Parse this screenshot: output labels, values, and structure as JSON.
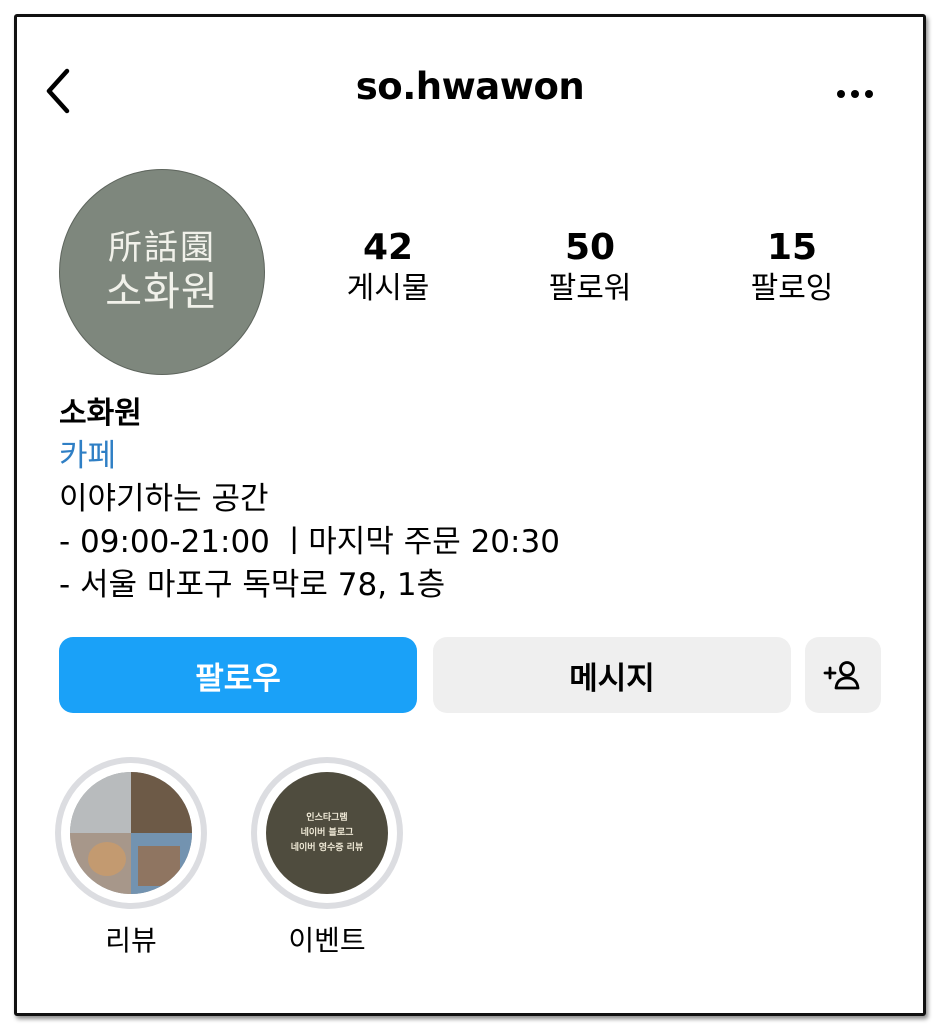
{
  "header": {
    "username": "so.hwawon",
    "back_icon": "chevron-left-icon",
    "more_icon": "ellipsis-icon"
  },
  "avatar": {
    "line1": "所話園",
    "line2": "소화원",
    "bg_color": "#7e877d"
  },
  "stats": [
    {
      "value": "42",
      "label": "게시물"
    },
    {
      "value": "50",
      "label": "팔로워"
    },
    {
      "value": "15",
      "label": "팔로잉"
    }
  ],
  "bio": {
    "name": "소화원",
    "category": "카페",
    "lines": [
      "이야기하는 공간",
      "- 09:00-21:00 ㅣ마지막 주문 20:30",
      "- 서울 마포구 독막로 78, 1층"
    ]
  },
  "buttons": {
    "follow": "팔로우",
    "message": "메시지",
    "add_user_icon": "add-person-icon"
  },
  "colors": {
    "follow_button": "#1aa1f8",
    "category_link": "#2f7fc5",
    "secondary_button": "#efefef"
  },
  "highlights": [
    {
      "label": "리뷰"
    },
    {
      "label": "이벤트",
      "cover_lines": [
        "인스타그램",
        "네이버 블로그",
        "네이버 영수증 리뷰"
      ]
    }
  ]
}
